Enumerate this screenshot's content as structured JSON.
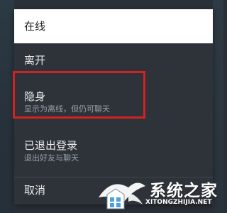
{
  "menu": {
    "items": [
      {
        "label": "在线",
        "description": ""
      },
      {
        "label": "离开",
        "description": ""
      },
      {
        "label": "隐身",
        "description": "显示为离线，但仍可聊天"
      },
      {
        "label": "已退出登录",
        "description": "退出好友与聊天"
      },
      {
        "label": "取消",
        "description": ""
      }
    ]
  },
  "watermark": {
    "name": "系统之家",
    "url": "XITONGZHIJIA.NET"
  },
  "colors": {
    "menu_bg": "#2e3339",
    "selected_bg": "#ffffff",
    "highlight": "#d32222"
  }
}
